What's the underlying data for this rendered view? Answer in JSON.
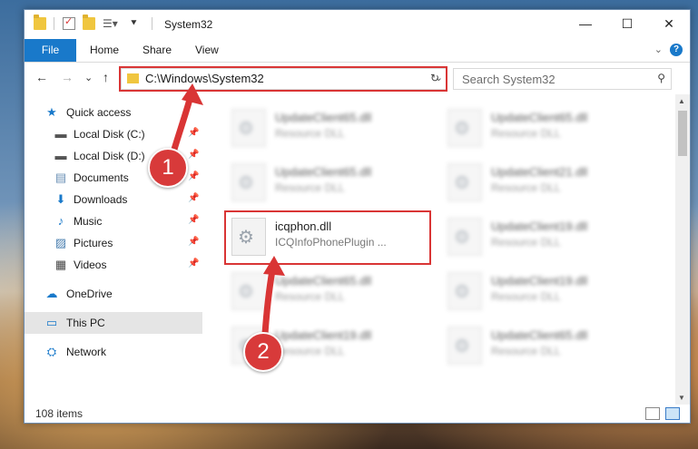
{
  "window": {
    "title": "System32",
    "controls": {
      "minimize": "—",
      "maximize": "☐",
      "close": "✕"
    }
  },
  "ribbon": {
    "file": "File",
    "tabs": [
      "Home",
      "Share",
      "View"
    ],
    "help": "?"
  },
  "nav": {
    "back": "←",
    "forward": "→",
    "recent": "⌄",
    "up": "↑",
    "address": "C:\\Windows\\System32",
    "search_placeholder": "Search System32"
  },
  "sidebar": {
    "items": [
      {
        "label": "Quick access",
        "icon": "star-icon"
      },
      {
        "label": "Local Disk (C:)",
        "icon": "drive-icon",
        "pinned": true
      },
      {
        "label": "Local Disk (D:)",
        "icon": "drive-icon",
        "pinned": true
      },
      {
        "label": "Documents",
        "icon": "documents-icon",
        "pinned": true
      },
      {
        "label": "Downloads",
        "icon": "downloads-icon",
        "pinned": true
      },
      {
        "label": "Music",
        "icon": "music-icon",
        "pinned": true
      },
      {
        "label": "Pictures",
        "icon": "pictures-icon",
        "pinned": true
      },
      {
        "label": "Videos",
        "icon": "videos-icon",
        "pinned": true
      },
      {
        "label": "OneDrive",
        "icon": "cloud-icon"
      },
      {
        "label": "This PC",
        "icon": "pc-icon",
        "selected": true
      },
      {
        "label": "Network",
        "icon": "network-icon"
      }
    ]
  },
  "files": [
    {
      "name": "UpdateClient65.dll",
      "type": "Resource DLL",
      "blurred": true
    },
    {
      "name": "UpdateClient65.dll",
      "type": "Resource DLL",
      "blurred": true
    },
    {
      "name": "UpdateClient65.dll",
      "type": "Resource DLL",
      "blurred": true
    },
    {
      "name": "UpdateClient21.dll",
      "type": "Resource DLL",
      "blurred": true
    },
    {
      "name": "icqphon.dll",
      "type": "ICQInfoPhonePlugin ...",
      "blurred": false,
      "highlighted": true
    },
    {
      "name": "UpdateClient19.dll",
      "type": "Resource DLL",
      "blurred": true
    },
    {
      "name": "UpdateClient65.dll",
      "type": "Resource DLL",
      "blurred": true
    },
    {
      "name": "UpdateClient19.dll",
      "type": "Resource DLL",
      "blurred": true
    },
    {
      "name": "UpdateClient19.dll",
      "type": "Resource DLL",
      "blurred": true
    },
    {
      "name": "UpdateClient65.dll",
      "type": "Resource DLL",
      "blurred": true
    }
  ],
  "status": {
    "count": "108 items"
  },
  "annotations": {
    "step1": "1",
    "step2": "2",
    "color": "#d93535"
  }
}
